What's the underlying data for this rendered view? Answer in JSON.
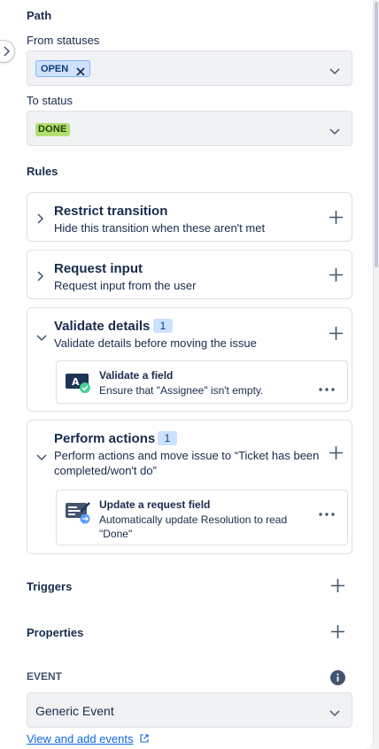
{
  "path": {
    "heading": "Path",
    "from_label": "From statuses",
    "from_tag": "OPEN",
    "to_label": "To status",
    "to_value": "DONE"
  },
  "rules": {
    "heading": "Rules",
    "items": [
      {
        "title": "Restrict transition",
        "description": "Hide this transition when these aren't met"
      },
      {
        "title": "Request input",
        "description": "Request input from the user"
      },
      {
        "title": "Validate details",
        "count": "1",
        "description": "Validate details before moving the issue",
        "child": {
          "title": "Validate a field",
          "description": "Ensure that \"Assignee\" isn't empty."
        }
      },
      {
        "title": "Perform actions",
        "count": "1",
        "description_line1": "Perform actions and move issue to “Ticket has been",
        "description_line2": "completed/won't do”",
        "child": {
          "title": "Update a request field",
          "description_line1": "Automatically update Resolution to read",
          "description_line2": "\"Done\""
        }
      }
    ]
  },
  "triggers": {
    "label": "Triggers"
  },
  "properties": {
    "label": "Properties"
  },
  "event": {
    "label": "EVENT",
    "value": "Generic Event",
    "link": "View and add events"
  },
  "colors": {
    "open_tag_bg": "#cfe1fd",
    "done_lozenge_bg": "#b3df72",
    "badge_bg": "#cce0ff",
    "link": "#0c66e4"
  }
}
